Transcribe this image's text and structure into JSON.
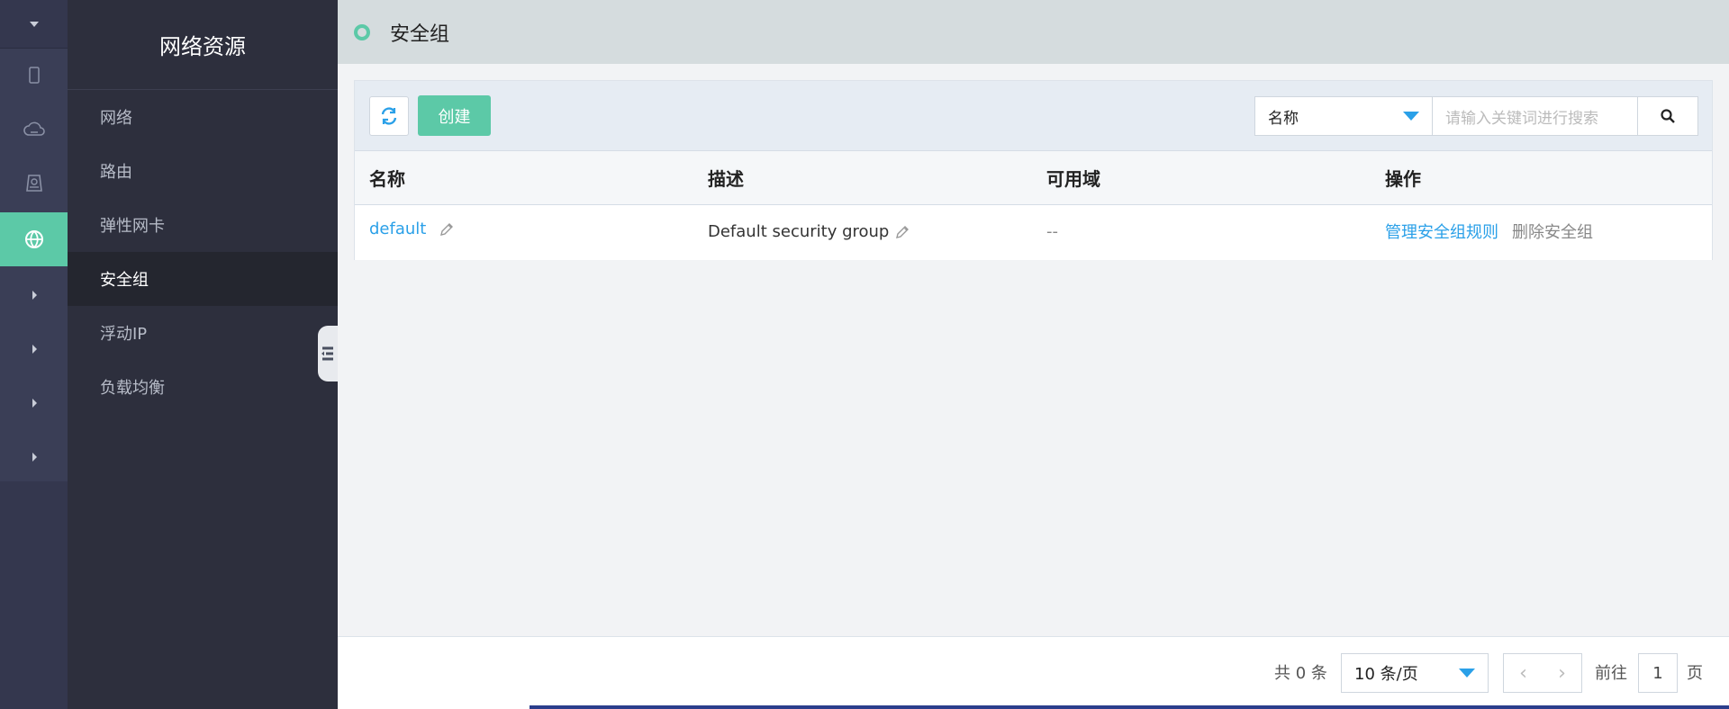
{
  "rail": {
    "items": [
      {
        "icon": "phone-icon",
        "active": false
      },
      {
        "icon": "cloud-icon",
        "active": false
      },
      {
        "icon": "storage-icon",
        "active": false
      },
      {
        "icon": "globe-icon",
        "active": true
      },
      {
        "icon": "caret-right-icon",
        "active": false
      },
      {
        "icon": "caret-right-icon",
        "active": false
      },
      {
        "icon": "caret-right-icon",
        "active": false
      },
      {
        "icon": "caret-right-icon",
        "active": false
      }
    ]
  },
  "sidebar": {
    "title": "网络资源",
    "items": [
      {
        "label": "网络",
        "active": false
      },
      {
        "label": "路由",
        "active": false
      },
      {
        "label": "弹性网卡",
        "active": false
      },
      {
        "label": "安全组",
        "active": true
      },
      {
        "label": "浮动IP",
        "active": false
      },
      {
        "label": "负载均衡",
        "active": false
      }
    ]
  },
  "header": {
    "title": "安全组"
  },
  "toolbar": {
    "create_label": "创建",
    "search_field": "名称",
    "search_placeholder": "请输入关键词进行搜索"
  },
  "table": {
    "columns": [
      "名称",
      "描述",
      "可用域",
      "操作"
    ],
    "rows": [
      {
        "name": "default",
        "description": "Default security group",
        "zone": "--",
        "actions": [
          "管理安全组规则",
          "删除安全组"
        ]
      }
    ]
  },
  "footer": {
    "total": "共 0 条",
    "page_size": "10 条/页",
    "goto_label": "前往",
    "page": "1",
    "page_unit": "页"
  },
  "colors": {
    "accent": "#5cc9a7",
    "link": "#2aa0e8",
    "sidebar_bg": "#2d2f3d",
    "rail_bg": "#3a3e56"
  }
}
